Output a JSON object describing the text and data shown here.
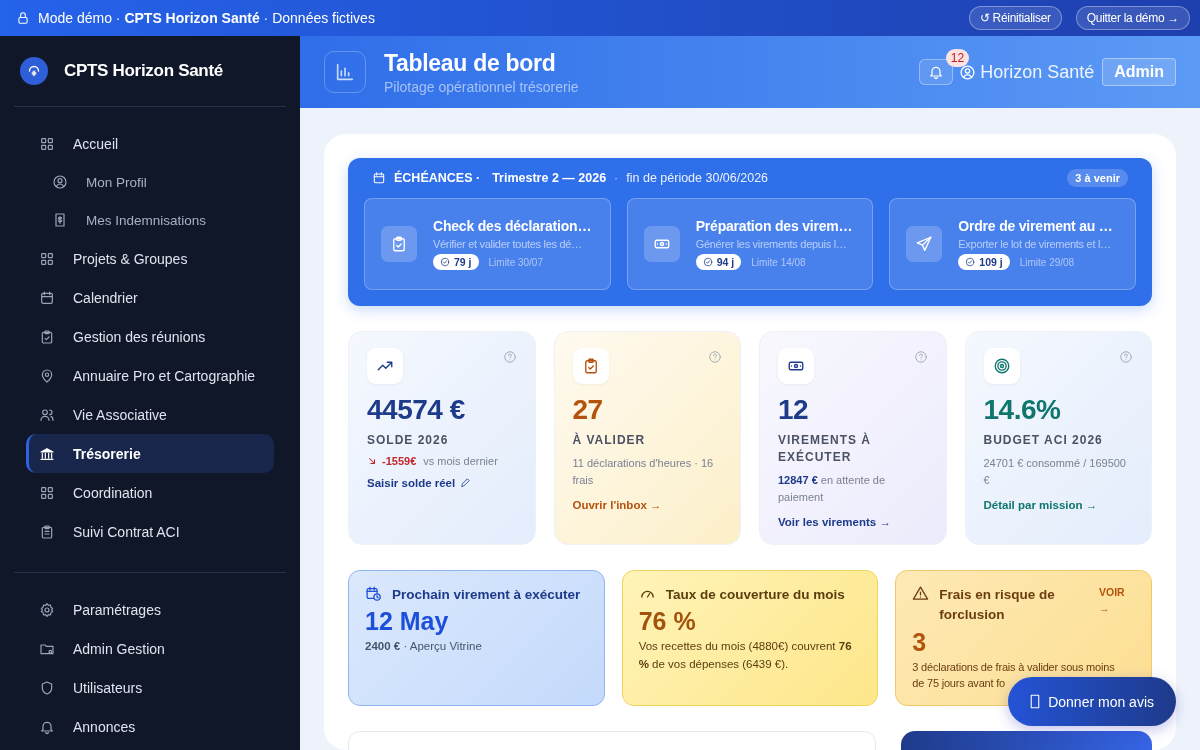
{
  "banner": {
    "text": "Mode démo · **CPTS Horizon Santé** · Données fictives",
    "buttons": [
      "↺ Réinitialiser",
      "Quitter la démo →"
    ]
  },
  "sidebar": {
    "brand": "CPTS Horizon Santé",
    "items": [
      {
        "label": "Accueil",
        "selected": false,
        "children": [
          {
            "label": "Mon Profil",
            "selected": false
          },
          {
            "label": "Mes Indemnisations",
            "selected": false
          }
        ]
      },
      {
        "label": "Projets & Groupes",
        "selected": false
      },
      {
        "label": "Calendrier",
        "selected": false
      },
      {
        "label": "Gestion des réunions",
        "selected": false
      },
      {
        "label": "Annuaire Pro et Cartographie",
        "selected": false
      },
      {
        "label": "Vie Associative",
        "selected": false
      },
      {
        "label": "Trésorerie",
        "selected": true
      },
      {
        "label": "Coordination",
        "selected": false
      },
      {
        "label": "Suivi Contrat ACI",
        "selected": false
      }
    ],
    "admin_items": [
      {
        "label": "Paramétrages",
        "selected": false
      },
      {
        "label": "Admin Gestion",
        "selected": false
      },
      {
        "label": "Utilisateurs",
        "selected": false
      },
      {
        "label": "Annonces",
        "selected": false
      }
    ]
  },
  "header": {
    "title": "Tableau de bord",
    "subtitle": "Pilotage opérationnel trésorerie",
    "notifications": "12",
    "user": "Horizon Santé",
    "role": "Admin"
  },
  "deadlines": {
    "label": "ÉCHÉANCES ·",
    "period": "Trimestre 2 — 2026",
    "separator": "·",
    "end": "fin de période 30/06/2026",
    "count": "3 à venir",
    "tasks": [
      {
        "title": "Check des déclaration…",
        "description": "Vérifier et valider toutes les dé…",
        "days": "79 j",
        "limit": "Limite 30/07"
      },
      {
        "title": "Préparation des virem…",
        "description": "Générer les virements depuis l…",
        "days": "94 j",
        "limit": "Limite 14/08"
      },
      {
        "title": "Ordre de virement au …",
        "description": "Exporter le lot de virements et l…",
        "days": "109 j",
        "limit": "Limite 29/08"
      }
    ]
  },
  "kpis": [
    {
      "value": "44574 €",
      "label": "SOLDE 2026",
      "delta": "-1559€",
      "delta_note": "vs mois dernier",
      "link": "Saisir solde réel"
    },
    {
      "value": "27",
      "label": "À VALIDER",
      "detail": "11 déclarations d'heures · 16 frais",
      "link": "Ouvrir l'inbox →"
    },
    {
      "value": "12",
      "label": "VIREMENTS À EXÉCUTER",
      "detail": "**12847 €** en attente de paiement",
      "link": "Voir les virements →"
    },
    {
      "value": "14.6%",
      "label": "BUDGET ACI 2026",
      "detail": "24701 € consommé / 169500 €",
      "link": "Détail par mission →"
    }
  ],
  "alerts": [
    {
      "title": "Prochain virement à exécuter",
      "value": "12 May",
      "detail": "**2400 €** · Aperçu Vitrine"
    },
    {
      "title": "Taux de couverture du mois",
      "value": "76 %",
      "detail": "Vos recettes du mois (4880€) couvrent **76 %** de vos dépenses (6439 €)."
    },
    {
      "title": "Frais en risque de forclusion",
      "value": "3",
      "detail": "3 déclarations de frais à valider sous moins de 75 jours avant fo",
      "link": "VOIR →"
    }
  ],
  "feedback_button": "Donner mon avis"
}
